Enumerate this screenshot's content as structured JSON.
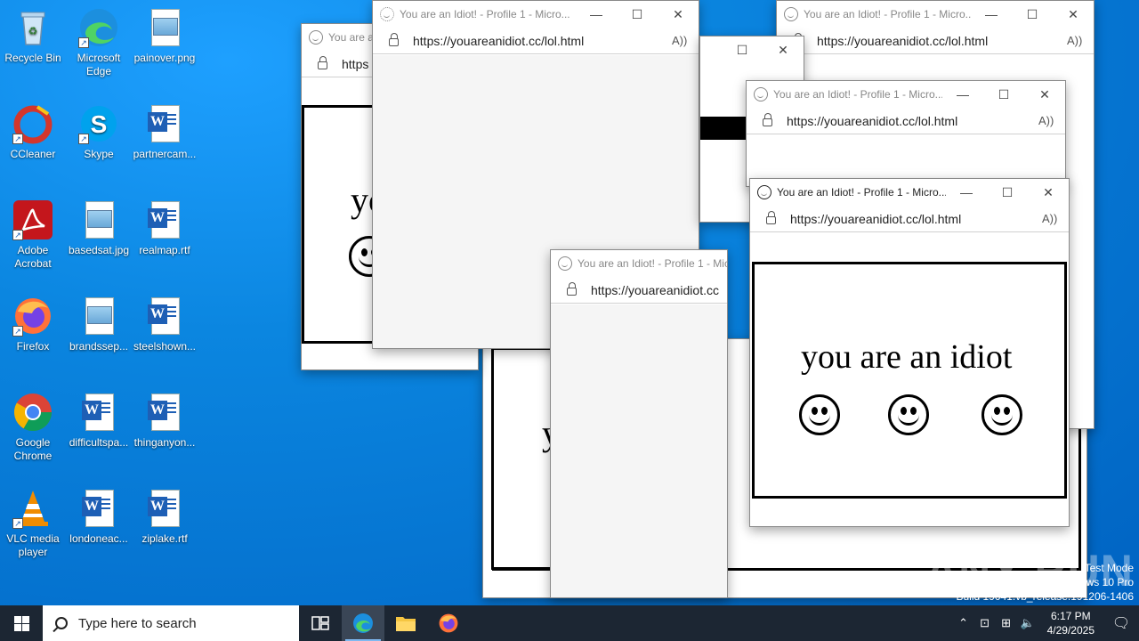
{
  "desktop_icons": [
    {
      "label": "Recycle Bin",
      "icon": "recycle-bin-icon"
    },
    {
      "label": "Microsoft Edge",
      "icon": "edge-icon"
    },
    {
      "label": "painover.png",
      "icon": "image-file-icon"
    },
    {
      "label": "CCleaner",
      "icon": "ccleaner-icon"
    },
    {
      "label": "Skype",
      "icon": "skype-icon"
    },
    {
      "label": "partnercam...",
      "icon": "word-doc-icon"
    },
    {
      "label": "Adobe Acrobat",
      "icon": "acrobat-icon"
    },
    {
      "label": "basedsat.jpg",
      "icon": "image-file-icon"
    },
    {
      "label": "realmap.rtf",
      "icon": "word-doc-icon"
    },
    {
      "label": "Firefox",
      "icon": "firefox-icon"
    },
    {
      "label": "brandssep...",
      "icon": "image-file-icon"
    },
    {
      "label": "steelshown...",
      "icon": "word-doc-icon"
    },
    {
      "label": "Google Chrome",
      "icon": "chrome-icon"
    },
    {
      "label": "difficultspa...",
      "icon": "word-doc-icon"
    },
    {
      "label": "thinganyon...",
      "icon": "word-doc-icon"
    },
    {
      "label": "VLC media player",
      "icon": "vlc-icon"
    },
    {
      "label": "londoneac...",
      "icon": "word-doc-icon"
    },
    {
      "label": "ziplake.rtf",
      "icon": "word-doc-icon"
    }
  ],
  "browser": {
    "title": "You are an Idiot! - Profile 1 - Micro...",
    "title_short": "You are an Idiot! - Profile 1 - Mic",
    "title_cut": "You are ar",
    "url": "https://youareanidiot.cc/lol.html",
    "url_short": "https://youareanidiot.cc",
    "url_cut": "https",
    "minimize_glyph": "—",
    "maximize_glyph": "☐",
    "close_glyph": "✕",
    "read_aloud_glyph": "A))"
  },
  "page": {
    "text": "you are an idiot",
    "text_partial_1": "yc",
    "text_partial_2": "y"
  },
  "taskbar": {
    "search_placeholder": "Type here to search",
    "time": "6:17 PM",
    "date": "4/29/2025"
  },
  "system_info": {
    "line1": "Test Mode",
    "line2": "Windows 10 Pro",
    "line3": "Build 19041.vb_release.191206-1406"
  },
  "watermark": "ANY RUN"
}
